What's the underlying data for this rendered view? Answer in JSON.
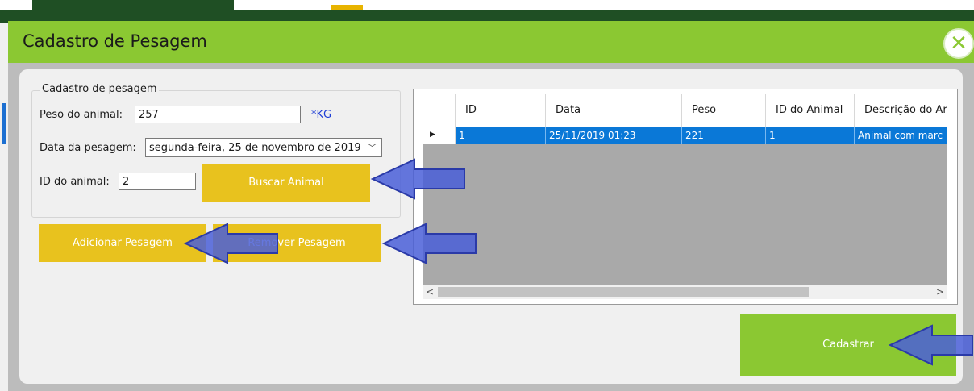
{
  "window": {
    "title": "Cadastro de Pesagem",
    "close_icon": "close-icon",
    "accent_color": "#8bc832"
  },
  "form": {
    "group_title": "Cadastro de pesagem",
    "peso_label": "Peso do animal:",
    "peso_value": "257",
    "peso_unit": "*KG",
    "data_label": "Data da pesagem:",
    "data_value": "segunda-feira, 25 de novembro de 2019",
    "id_label": "ID do animal:",
    "id_value": "2",
    "buscar_label": "Buscar Animal",
    "adicionar_label": "Adicionar Pesagem",
    "remover_label": "Remover Pesagem",
    "cadastrar_label": "Cadastrar"
  },
  "grid": {
    "columns": [
      "ID",
      "Data",
      "Peso",
      "ID do Animal",
      "Descrição do Ar"
    ],
    "rows": [
      [
        "1",
        "25/11/2019 01:23",
        "221",
        "1",
        "Animal com marc"
      ]
    ]
  }
}
